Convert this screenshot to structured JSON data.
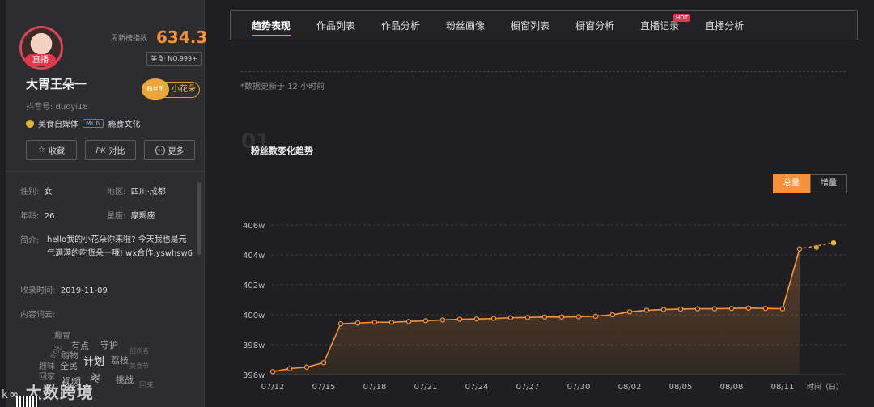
{
  "profile": {
    "live_label": "直播",
    "rank_label": "周新榜指数",
    "rank_value": "634.3",
    "rank_tag": "美食· NO.999+",
    "name": "大胃王朵一",
    "fans_badge_heart": "粉丝团",
    "fans_badge": "小花朵",
    "douyin_id": "抖音号: duoyi18",
    "tag_text": "美食自媒体",
    "mcn_label": "MCN",
    "mcn_name": "瘾食文化",
    "buttons": {
      "favorite": "收藏",
      "compare": "对比",
      "more": "更多"
    },
    "compare_icon": "PK",
    "gender_label": "性别:",
    "gender": "女",
    "region_label": "地区:",
    "region": "四川·成都",
    "age_label": "年龄:",
    "age": "26",
    "zodiac_label": "星座:",
    "zodiac": "摩羯座",
    "bio_label": "简介:",
    "bio": "hello我的小花朵你来啦? 今天我也是元气满满的吃货朵一哦! wx合作:yswhsw6",
    "collect_label": "收录时间:",
    "collect_time": "2019-11-09",
    "word_cloud_label": "内容词云:",
    "word_cloud": [
      "趣胃",
      "有点",
      "守护",
      "购物",
      "计划",
      "荔枝",
      "趣味",
      "全民",
      "创作者",
      "回家",
      "视频",
      "挑战",
      "美食节",
      "回来",
      "时光",
      "美"
    ],
    "watermark": "大数跨境"
  },
  "tabs": [
    {
      "label": "趋势表现",
      "active": true
    },
    {
      "label": "作品列表"
    },
    {
      "label": "作品分析"
    },
    {
      "label": "粉丝画像"
    },
    {
      "label": "橱窗列表"
    },
    {
      "label": "橱窗分析"
    },
    {
      "label": "直播记录",
      "badge": "HOT"
    },
    {
      "label": "直播分析"
    }
  ],
  "note": "*数据更新于 12 小时前",
  "section_number": "01",
  "chart_title": "粉丝数变化趋势",
  "toggle": {
    "total": "总量",
    "increment": "增量"
  },
  "colors": {
    "accent": "#f5923b",
    "live": "#e3354c",
    "background": "#1f1f21"
  },
  "chart_data": {
    "type": "area",
    "ylim": [
      396,
      406
    ],
    "yticks": [
      "396w",
      "398w",
      "400w",
      "402w",
      "404w",
      "406w"
    ],
    "xticks": [
      "07/12",
      "07/15",
      "07/18",
      "07/21",
      "07/24",
      "07/27",
      "07/30",
      "08/02",
      "08/05",
      "08/08",
      "08/11"
    ],
    "xlabel": "时间（日）",
    "start_day": "07/12",
    "values": [
      396.2,
      396.4,
      396.5,
      396.8,
      399.4,
      399.45,
      399.5,
      399.5,
      399.55,
      399.6,
      399.65,
      399.7,
      399.72,
      399.75,
      399.8,
      399.82,
      399.85,
      399.85,
      399.87,
      399.9,
      400.0,
      400.2,
      400.3,
      400.35,
      400.38,
      400.4,
      400.4,
      400.42,
      400.45,
      400.42,
      400.4,
      404.4
    ],
    "forecast": [
      404.4,
      404.8
    ]
  }
}
